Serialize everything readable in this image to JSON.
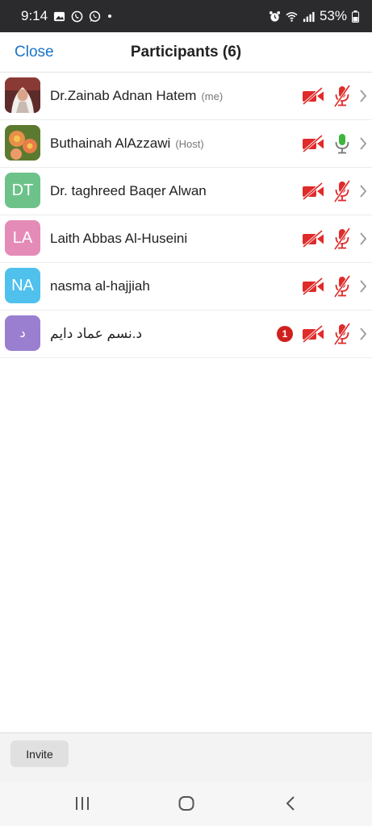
{
  "status_bar": {
    "time": "9:14",
    "battery": "53%",
    "icons": [
      "gallery-icon",
      "viber-icon",
      "whatsapp-icon",
      "alarm-icon",
      "wifi-icon",
      "signal-icon",
      "battery-icon"
    ]
  },
  "header": {
    "close_label": "Close",
    "title": "Participants (6)"
  },
  "participants": [
    {
      "name": "Dr.Zainab Adnan Hatem",
      "tag": "(me)",
      "avatar_type": "photo",
      "video": "off",
      "audio": "muted"
    },
    {
      "name": "Buthainah AlAzzawi",
      "tag": "(Host)",
      "avatar_type": "photo",
      "video": "off",
      "audio": "on"
    },
    {
      "name": "Dr. taghreed Baqer Alwan",
      "initials": "DT",
      "avatar_color": "#6dc28a",
      "video": "off",
      "audio": "muted"
    },
    {
      "name": "Laith Abbas Al-Huseini",
      "initials": "LA",
      "avatar_color": "#e58bb8",
      "video": "off",
      "audio": "muted"
    },
    {
      "name": "nasma al-hajjiah",
      "initials": "NA",
      "avatar_color": "#4fc1ec",
      "video": "off",
      "audio": "muted"
    },
    {
      "name": "د.نسم عماد دايم",
      "initials": "د",
      "avatar_color": "#9a7fd0",
      "video": "off",
      "audio": "muted",
      "chat_badge": "1"
    }
  ],
  "footer": {
    "invite_label": "Invite"
  },
  "colors": {
    "accent": "#1a73c9",
    "muted_red": "#e02b2b",
    "audio_green": "#3fb53f"
  }
}
